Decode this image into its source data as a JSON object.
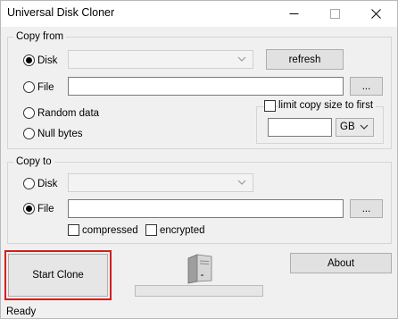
{
  "window": {
    "title": "Universal Disk Cloner",
    "minimize_icon": "minimize-icon",
    "maximize_icon": "maximize-icon",
    "close_icon": "close-icon"
  },
  "copy_from": {
    "legend": "Copy from",
    "disk_label": "Disk",
    "disk_selected": "",
    "refresh_label": "refresh",
    "file_label": "File",
    "file_value": "",
    "browse_label": "...",
    "random_label": "Random data",
    "null_label": "Null bytes",
    "selected_source": "Disk",
    "limit_label": "limit copy size to first",
    "limit_checked": false,
    "limit_value": "",
    "unit_selected": "GB"
  },
  "copy_to": {
    "legend": "Copy to",
    "disk_label": "Disk",
    "file_label": "File",
    "file_value": "",
    "browse_label": "...",
    "selected_target": "File",
    "compressed_label": "compressed",
    "compressed_checked": false,
    "encrypted_label": "encrypted",
    "encrypted_checked": false
  },
  "actions": {
    "start_label": "Start Clone",
    "about_label": "About",
    "progress": 0,
    "device_icon": "disk-drive-icon",
    "highlight_color": "#d11f1f"
  },
  "status": {
    "text": "Ready"
  }
}
